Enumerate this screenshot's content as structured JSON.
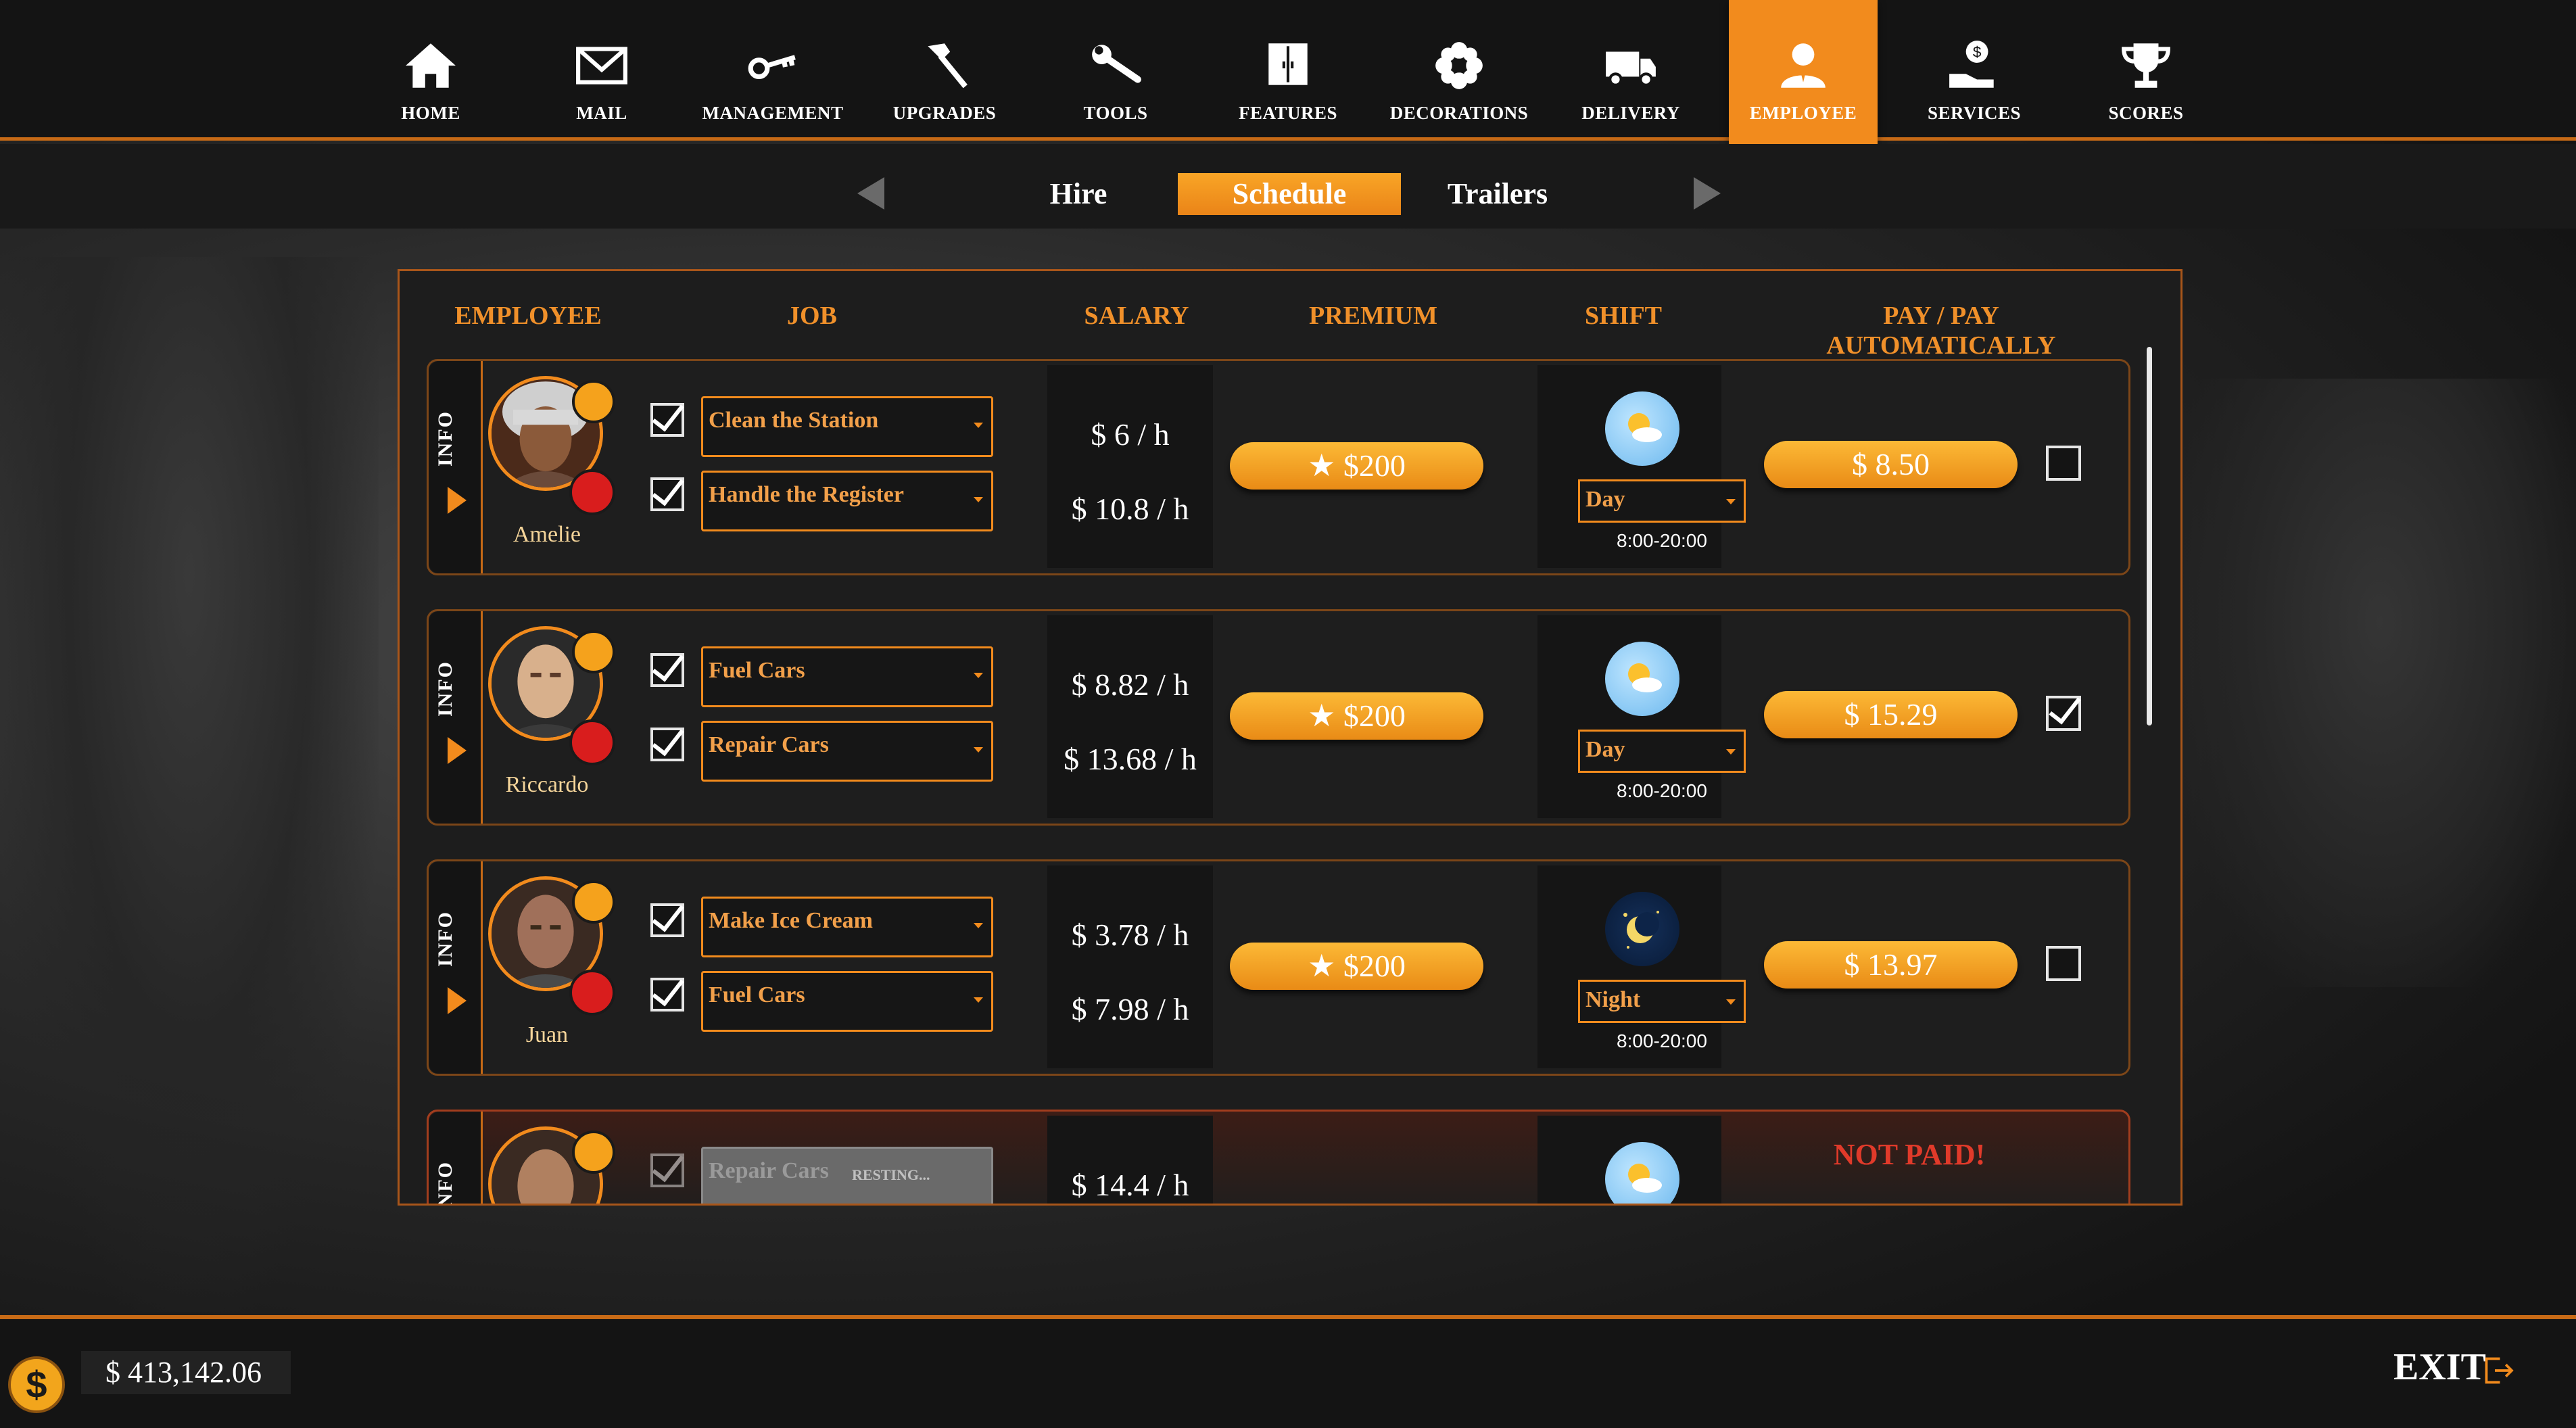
{
  "nav": [
    {
      "label": "HOME",
      "icon": "home-icon"
    },
    {
      "label": "MAIL",
      "icon": "mail-icon"
    },
    {
      "label": "MANAGEMENT",
      "icon": "key-icon"
    },
    {
      "label": "UPGRADES",
      "icon": "hammer-icon"
    },
    {
      "label": "TOOLS",
      "icon": "wrench-icon"
    },
    {
      "label": "FEATURES",
      "icon": "cabinet-icon"
    },
    {
      "label": "DECORATIONS",
      "icon": "flower-icon"
    },
    {
      "label": "DELIVERY",
      "icon": "truck-icon"
    },
    {
      "label": "EMPLOYEE",
      "icon": "employee-icon",
      "active": true
    },
    {
      "label": "SERVICES",
      "icon": "hand-coin-icon"
    },
    {
      "label": "SCORES",
      "icon": "trophy-icon"
    }
  ],
  "tabs": {
    "hire": "Hire",
    "schedule": "Schedule",
    "trailers": "Trailers",
    "active": "Schedule"
  },
  "columns": {
    "employee": "EMPLOYEE",
    "job": "JOB",
    "salary": "SALARY",
    "premium": "PREMIUM",
    "shift": "SHIFT",
    "pay": "PAY / PAY AUTOMATICALLY"
  },
  "info_label": "INFO",
  "employees": [
    {
      "name": "Amelie",
      "job1": "Clean the Station",
      "job2": "Handle the Register",
      "salary1": "$ 6 / h",
      "salary2": "$ 10.8 / h",
      "premium": "$200",
      "shift": "Day",
      "hours": "8:00-20:00",
      "pay": "$ 8.50",
      "auto_pay": false
    },
    {
      "name": "Riccardo",
      "job1": "Fuel Cars",
      "job2": "Repair Cars",
      "salary1": "$ 8.82 / h",
      "salary2": "$ 13.68 / h",
      "premium": "$200",
      "shift": "Day",
      "hours": "8:00-20:00",
      "pay": "$ 15.29",
      "auto_pay": true
    },
    {
      "name": "Juan",
      "job1": "Make Ice Cream",
      "job2": "Fuel Cars",
      "salary1": "$ 3.78 / h",
      "salary2": "$ 7.98 / h",
      "premium": "$200",
      "shift": "Night",
      "hours": "8:00-20:00",
      "pay": "$ 13.97",
      "auto_pay": false
    },
    {
      "job1": "Repair Cars",
      "job1_status": "RESTING...",
      "salary1": "$ 14.4 / h",
      "pay_status": "NOT PAID!"
    }
  ],
  "money": "$ 413,142.06",
  "exit_label": "EXIT",
  "colors": {
    "accent": "#f28b1d",
    "panel_border": "#a9561a",
    "not_paid": "#e03a2a",
    "job_text": "#f2a04a"
  }
}
